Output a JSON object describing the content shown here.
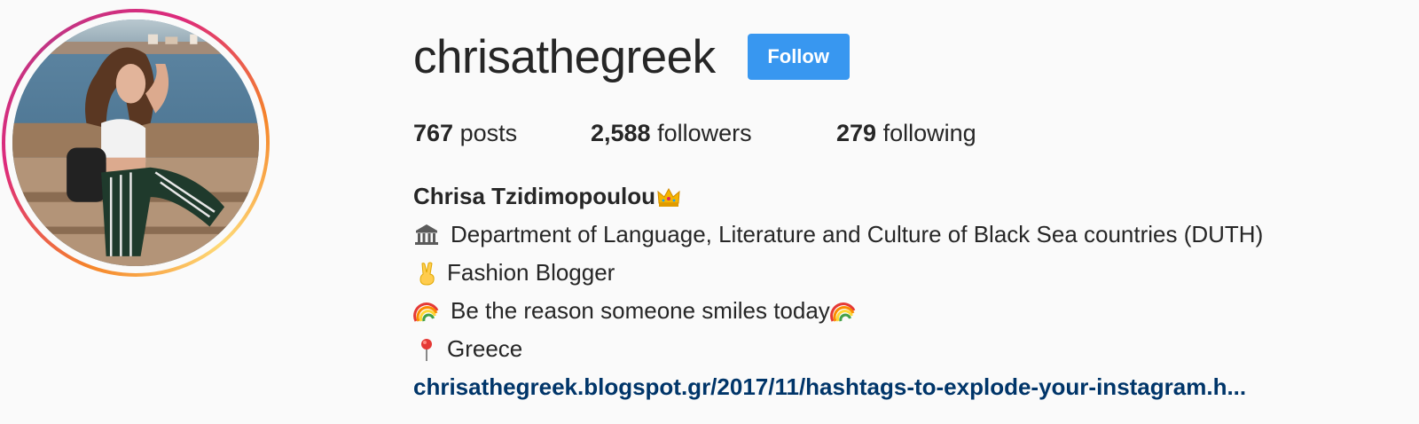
{
  "profile": {
    "username": "chrisathegreek",
    "follow_label": "Follow"
  },
  "stats": {
    "posts_count": "767",
    "posts_label": "posts",
    "followers_count": "2,588",
    "followers_label": "followers",
    "following_count": "279",
    "following_label": "following"
  },
  "bio": {
    "full_name": "Chrisa Tzidimopoulou",
    "full_name_emoji": "crown-icon",
    "lines": [
      {
        "icon": "classical-building-icon",
        "text": "Department of Language, Literature and Culture of Black Sea countries (DUTH)"
      },
      {
        "icon": "victory-hand-icon",
        "text": "Fashion Blogger"
      },
      {
        "icon": "rainbow-icon",
        "text": "Be the reason someone smiles today",
        "trailing_icon": "rainbow-icon"
      },
      {
        "icon": "round-pushpin-icon",
        "text": "Greece"
      }
    ],
    "link": "chrisathegreek.blogspot.gr/2017/11/hashtags-to-explode-your-instagram.h..."
  },
  "colors": {
    "follow_button": "#3897f0",
    "link": "#003569",
    "text": "#262626",
    "background": "#fafafa"
  }
}
